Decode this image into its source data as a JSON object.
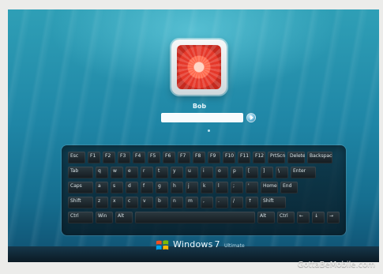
{
  "login": {
    "username": "Bob",
    "password_value": "",
    "password_placeholder": ""
  },
  "keyboard": {
    "rows": [
      [
        "Esc",
        "F1",
        "F2",
        "F3",
        "F4",
        "F5",
        "F6",
        "F7",
        "F8",
        "F9",
        "F10",
        "F11",
        "F12",
        "PrtScn",
        "Delete",
        "Backspace"
      ],
      [
        "Tab",
        "q",
        "w",
        "e",
        "r",
        "t",
        "y",
        "u",
        "i",
        "o",
        "p",
        "[",
        "]",
        "\\",
        "Enter"
      ],
      [
        "Caps",
        "a",
        "s",
        "d",
        "f",
        "g",
        "h",
        "j",
        "k",
        "l",
        ";",
        "'",
        "Home",
        "End"
      ],
      [
        "Shift",
        "z",
        "x",
        "c",
        "v",
        "b",
        "n",
        "m",
        ",",
        ".",
        "/",
        "↑",
        "Shift"
      ],
      [
        "Ctrl",
        "Win",
        "Alt",
        "",
        "Alt",
        "Ctrl",
        "←",
        "↓",
        "→"
      ]
    ]
  },
  "branding": {
    "logo_name": "windows-logo",
    "os_name": "Windows",
    "os_version": "7",
    "edition": "Ultimate"
  },
  "watermark": "GottaBeMobile.com",
  "colors": {
    "screen_top": "#2f9fb6",
    "screen_bottom": "#0f4f70",
    "keyboard_bg": "#0a2837",
    "key_bg": "#2c3a41",
    "avatar_red": "#e5382a",
    "text_light": "#e7f6fb"
  }
}
